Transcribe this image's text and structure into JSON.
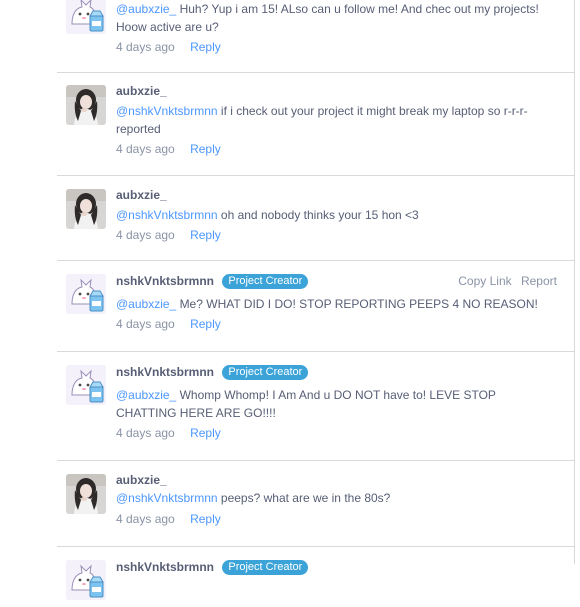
{
  "comments": [
    {
      "username": "",
      "is_creator": false,
      "avatar": "cat-milk-avatar",
      "mention": "@aubxzie_",
      "text": "Huh? Yup i am 15! ALso can u follow me! And chec out my projects!",
      "text_line2": "Hoow active are u?",
      "time": "4 days ago",
      "reply_label": "Reply"
    },
    {
      "username": "aubxzie_",
      "is_creator": false,
      "avatar": "girl-photo-avatar",
      "mention": "@nshkVnktsbrmnn",
      "text": "if i check out your project it might break my laptop so r-r-r-",
      "text_line2": "reported",
      "time": "4 days ago",
      "reply_label": "Reply"
    },
    {
      "username": "aubxzie_",
      "is_creator": false,
      "avatar": "girl-photo-avatar",
      "mention": "@nshkVnktsbrmnn",
      "text": "oh and nobody thinks your 15 hon <3",
      "time": "4 days ago",
      "reply_label": "Reply"
    },
    {
      "username": "nshkVnktsbrmnn",
      "is_creator": true,
      "badge": "Project Creator",
      "avatar": "cat-milk-avatar",
      "mention": "@aubxzie_",
      "text": "Me? WHAT DID I DO! STOP REPORTING PEEPS 4 NO REASON!",
      "time": "4 days ago",
      "reply_label": "Reply",
      "copy_link": "Copy Link",
      "report": "Report"
    },
    {
      "username": "nshkVnktsbrmnn",
      "is_creator": true,
      "badge": "Project Creator",
      "avatar": "cat-milk-avatar",
      "mention": "@aubxzie_",
      "text": "Whomp Whomp! I Am And u DO NOT have to! LEVE STOP",
      "text_line2": "CHATTING HERE ARE GO!!!!",
      "time": "4 days ago",
      "reply_label": "Reply"
    },
    {
      "username": "aubxzie_",
      "is_creator": false,
      "avatar": "girl-photo-avatar",
      "mention": "@nshkVnktsbrmnn",
      "text": "peeps? what are we in the 80s?",
      "time": "4 days ago",
      "reply_label": "Reply"
    },
    {
      "username": "nshkVnktsbrmnn",
      "is_creator": true,
      "badge": "Project Creator",
      "avatar": "cat-milk-avatar"
    }
  ],
  "colors": {
    "link": "#4c97ff",
    "badge": "#3ba3d8",
    "text": "#575e75",
    "meta": "#8a93a6",
    "divider": "#d9d9d9"
  }
}
